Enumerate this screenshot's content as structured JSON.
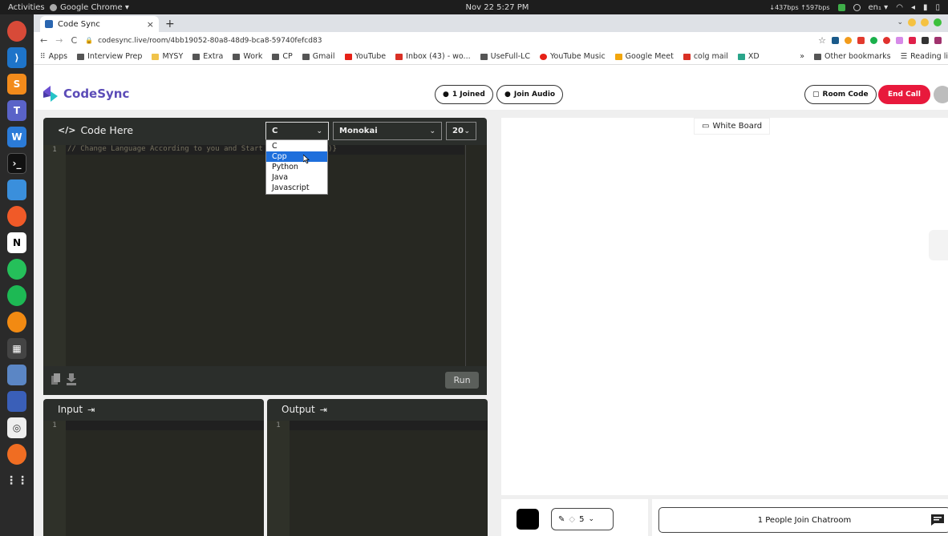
{
  "os": {
    "activities": "Activities",
    "app_name": "Google Chrome ▾",
    "clock": "Nov 22  5:27 PM",
    "net_speed": "↓437bps ↑597bps",
    "lang": "en₁ ▾"
  },
  "browser": {
    "tab_title": "Code Sync",
    "tab_close": "×",
    "new_tab": "+",
    "url": "codesync.live/room/4bb19052-80a8-48d9-bca8-59740fefcd83",
    "bookmarks": [
      "Apps",
      "Interview Prep",
      "MYSY",
      "Extra",
      "Work",
      "CP",
      "Gmail",
      "YouTube",
      "Inbox (43) - wo...",
      "UseFull-LC",
      "YouTube Music",
      "Google Meet",
      "colg mail",
      "XD"
    ],
    "bookmarks_more": "»",
    "other_bookmarks": "Other bookmarks",
    "reading_list": "Reading li"
  },
  "app": {
    "logo": "CodeSync",
    "joined_label": "1 Joined",
    "join_audio_label": "Join Audio",
    "room_code_label": "Room Code",
    "end_call_label": "End Call"
  },
  "editor": {
    "title": "Code Here",
    "language_selected": "C",
    "theme_selected": "Monokai",
    "font_size": "20",
    "language_options": [
      "C",
      "Cpp",
      "Python",
      "Java",
      "Javascript"
    ],
    "highlighted_option": "Cpp",
    "line_number": "1",
    "code_line": "// Change Language According to you and Start Writing code :)}",
    "run_label": "Run"
  },
  "input_panel": {
    "title": "Input",
    "line_number": "1"
  },
  "output_panel": {
    "title": "Output",
    "line_number": "1"
  },
  "whiteboard": {
    "label": "White Board",
    "brush_size": "5",
    "chat_text": "1 People Join Chatroom"
  },
  "colors": {
    "brand": "#5b4bb7",
    "end_call": "#e8193c",
    "editor_bg": "#272822",
    "dropdown_highlight": "#1e6fdc"
  }
}
